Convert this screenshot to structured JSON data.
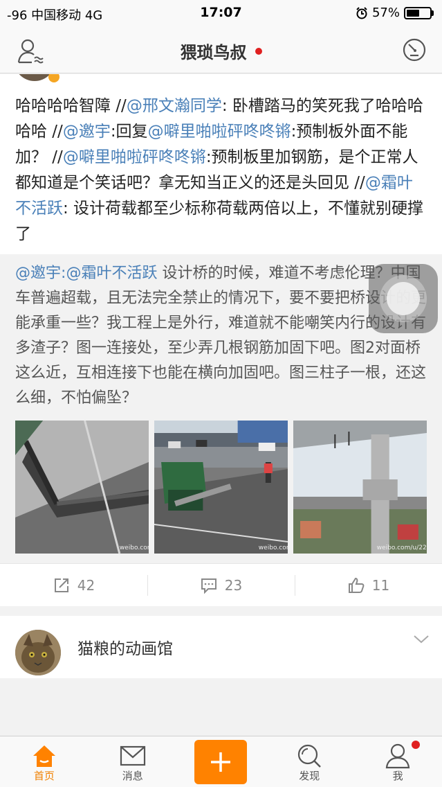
{
  "status_bar": {
    "left": "-96 中国移动  4G",
    "time": "17:07",
    "battery_text": "57%",
    "battery_level": 0.57
  },
  "nav": {
    "title": "猥琐鸟叔"
  },
  "post": {
    "segments": [
      {
        "text": "哈哈哈哈智障 //",
        "type": "text"
      },
      {
        "text": "@邢文瀚同学",
        "type": "mention"
      },
      {
        "text": ": 卧槽踏马的笑死我了哈哈哈哈哈 //",
        "type": "text"
      },
      {
        "text": "@邀宇",
        "type": "mention"
      },
      {
        "text": ":回复",
        "type": "text"
      },
      {
        "text": "@噼里啪啦砰咚咚锵",
        "type": "mention"
      },
      {
        "text": ":预制板外面不能加？ //",
        "type": "text"
      },
      {
        "text": "@噼里啪啦砰咚咚锵",
        "type": "mention"
      },
      {
        "text": ":预制板里加钢筋，是个正常人都知道是个笑话吧？拿无知当正义的还是头回见 //",
        "type": "text"
      },
      {
        "text": "@霜叶不活跃",
        "type": "mention"
      },
      {
        "text": ": 设计荷载都至少标称荷载两倍以上，不懂就别硬撑了",
        "type": "text"
      }
    ]
  },
  "retweet": {
    "segments": [
      {
        "text": "@邀宇",
        "type": "mention"
      },
      {
        "text": ":",
        "type": "mention"
      },
      {
        "text": "@霜叶不活跃",
        "type": "mention"
      },
      {
        "text": " 设计桥的时候，难道不考虑伦理？中国车普遍超载，且无法完全禁止的情况下，要不要把桥设计的更能承重一些？我工程上是外行，难道就不能嘲笑内行的设计有多渣子？图一连接处，至少弄几根钢筋加固下吧。图2对面桥这么近，互相连接下也能在横向加固吧。图三柱子一根，还这么细，不怕偏坠？",
        "type": "text"
      }
    ],
    "images": [
      {
        "name": "bridge-joint-photo",
        "watermark": "weibo.com"
      },
      {
        "name": "truck-accident-photo",
        "watermark": "weibo.com"
      },
      {
        "name": "bridge-pillar-photo",
        "watermark": "weibo.com/u/22"
      }
    ]
  },
  "actions": {
    "repost": "42",
    "comment": "23",
    "like": "11"
  },
  "next_card": {
    "name": "猫粮的动画馆"
  },
  "tabs": {
    "home": "首页",
    "messages": "消息",
    "discover": "发现",
    "me": "我"
  },
  "colors": {
    "accent": "#ff8200",
    "mention": "#4a80b8",
    "badge": "#e02020"
  }
}
